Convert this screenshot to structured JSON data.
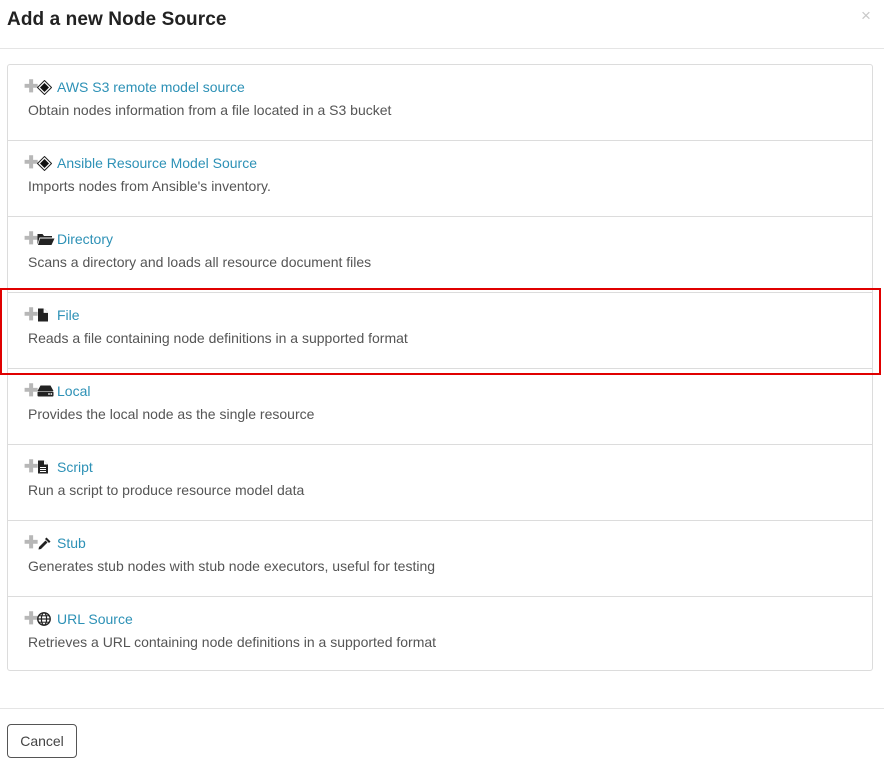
{
  "dialog": {
    "title": "Add a new Node Source",
    "close_glyph": "×",
    "cancel_label": "Cancel"
  },
  "plus_glyph": "✚",
  "sources": [
    {
      "icon": "diamond-icon",
      "name": "AWS S3 remote model source",
      "description": "Obtain nodes information from a file located in a S3 bucket"
    },
    {
      "icon": "diamond-icon",
      "name": "Ansible Resource Model Source",
      "description": "Imports nodes from Ansible's inventory."
    },
    {
      "icon": "folder-open-icon",
      "name": "Directory",
      "description": "Scans a directory and loads all resource document files"
    },
    {
      "icon": "file-icon",
      "name": "File",
      "description": "Reads a file containing node definitions in a supported format"
    },
    {
      "icon": "hdd-icon",
      "name": "Local",
      "description": "Provides the local node as the single resource"
    },
    {
      "icon": "file-text-icon",
      "name": "Script",
      "description": "Run a script to produce resource model data"
    },
    {
      "icon": "eyedropper-icon",
      "name": "Stub",
      "description": "Generates stub nodes with stub node executors, useful for testing"
    },
    {
      "icon": "globe-icon",
      "name": "URL Source",
      "description": "Retrieves a URL containing node definitions in a supported format"
    }
  ],
  "colors": {
    "link": "#2d91b6",
    "highlight": "#e00000"
  }
}
